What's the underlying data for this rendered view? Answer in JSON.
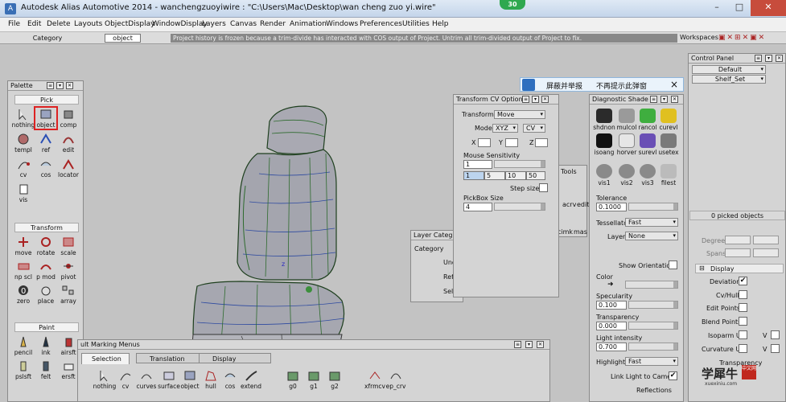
{
  "window": {
    "title": "Autodesk Alias Automotive 2014   -  wanchengzuoyiwire : \"C:\\Users\\Mac\\Desktop\\wan cheng zuo yi.wire\"",
    "badge": "30"
  },
  "menu": [
    "File",
    "Edit",
    "Delete",
    "Layouts",
    "ObjectDisplay",
    "WindowDisplay",
    "Layers",
    "Canvas",
    "Render",
    "Animation",
    "Windows",
    "Preferences",
    "Utilities",
    "Help"
  ],
  "toolbar": {
    "category": "Category",
    "object": "object",
    "message": "Project history is frozen because a trim-divide has interacted with COS output of Project.  Untrim all trim-divided output of Project to fix.",
    "workspaces": "Workspaces"
  },
  "palette": {
    "title": "Palette",
    "sections": {
      "pick": "Pick",
      "transform": "Transform",
      "paint": "Paint"
    },
    "pick_tools": [
      "nothing",
      "object",
      "comp",
      "templ",
      "ref",
      "edit",
      "cv",
      "cos",
      "locator",
      "vis"
    ],
    "transform_tools": [
      "move",
      "rotate",
      "scale",
      "np scl",
      "p mod",
      "pivot",
      "zero",
      "place",
      "array"
    ],
    "paint_tools": [
      "pencil",
      "ink",
      "airsft",
      "pslsft",
      "felt",
      "ersft"
    ]
  },
  "marking_menus": {
    "title": "ult Marking Menus",
    "tabs": [
      "Selection",
      "Translation",
      "Display"
    ],
    "tools": [
      "nothing",
      "cv",
      "curves",
      "surface",
      "object",
      "hull",
      "cos",
      "extend",
      "g0",
      "g1",
      "g2",
      "xfrmcv",
      "ep_crv"
    ]
  },
  "transform_cv": {
    "title": "Transform CV Options",
    "transform_label": "Transform",
    "transform_value": "Move",
    "mode_label": "Mode",
    "mode_value": "XYZ",
    "mode2_value": "CV",
    "x_label": "X",
    "y_label": "Y",
    "z_label": "Z",
    "mouse_sens_label": "Mouse Sensitivity",
    "mouse_sens_value": "1",
    "step_values": [
      "1",
      "5",
      "10",
      "50"
    ],
    "step_size_label": "Step size",
    "pickbox_label": "PickBox Size",
    "pickbox_value": "4"
  },
  "tools_panel": {
    "title": "Tools",
    "items": [
      "acrv",
      "edit",
      "cimk",
      "mas"
    ]
  },
  "layer_panel": {
    "title": "Layer Categ",
    "header": "Category",
    "rows": [
      "Und",
      "Refe",
      "Sele"
    ]
  },
  "notification": {
    "report": "屏蔽并举报",
    "dont_show": "不再提示此弹窗",
    "close": "×"
  },
  "diagnostic": {
    "title": "Diagnostic Shade",
    "shades": [
      "shdnon",
      "mulcol",
      "rancol",
      "curevl",
      "isoang",
      "horver",
      "surevl",
      "usetex",
      "vis1",
      "vis2",
      "vis3",
      "filest"
    ],
    "tolerance_label": "Tolerance",
    "tolerance_value": "0.1000",
    "tessellator_label": "Tessellator",
    "tessellator_value": "Fast",
    "layer_label": "Layer",
    "layer_value": "None",
    "show_orientation": "Show Orientation",
    "color_label": "Color",
    "specularity_label": "Specularity",
    "specularity_value": "0.100",
    "transparency_label": "Transparency",
    "transparency_value": "0.000",
    "light_intensity_label": "Light intensity",
    "light_intensity_value": "0.700",
    "highlights_label": "Highlights",
    "highlights_value": "Fast",
    "link_light": "Link Light to Camera",
    "reflections": "Reflections"
  },
  "control_panel": {
    "title": "Control Panel",
    "default_value": "Default",
    "shelf_value": "Shelf_Set",
    "picked": "0 picked objects",
    "degree_label": "Degree",
    "spans_label": "Spans",
    "display_label": "Display",
    "items": [
      "Deviation",
      "Cv/Hull",
      "Edit Points",
      "Blend Points",
      "Isoparm U",
      "Curvature U",
      "Transparency"
    ],
    "v_label": "V"
  },
  "watermark": {
    "brand": "学犀牛",
    "site": "xuexiniu.com",
    "tag": "中文网"
  }
}
